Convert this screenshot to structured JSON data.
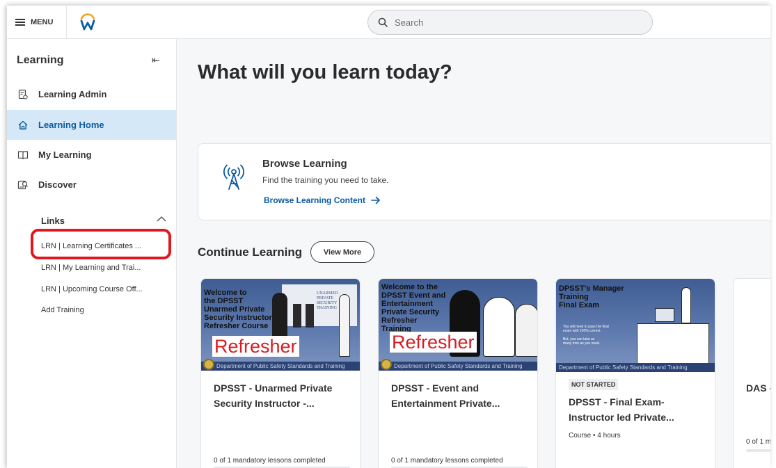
{
  "topbar": {
    "menu_label": "MENU",
    "search_placeholder": "Search"
  },
  "sidebar": {
    "title": "Learning",
    "items": [
      {
        "label": "Learning Admin",
        "icon": "admin-doc-icon"
      },
      {
        "label": "Learning Home",
        "icon": "home-icon",
        "active": true
      },
      {
        "label": "My Learning",
        "icon": "book-icon"
      },
      {
        "label": "Discover",
        "icon": "discover-icon"
      }
    ],
    "links_label": "Links",
    "links": [
      "LRN | Learning Certificates ...",
      "LRN | My Learning and Trai...",
      "LRN | Upcoming Course Off...",
      "Add Training"
    ]
  },
  "main": {
    "headline": "What will you learn today?",
    "browse": {
      "title": "Browse Learning",
      "description": "Find the training you need to take.",
      "link": "Browse Learning Content"
    },
    "continue_title": "Continue Learning",
    "view_more": "View More",
    "courses": [
      {
        "thumb_text": "Welcome to\nthe DPSST\nUnarmed Private\nSecurity Instructor\nRefresher Course",
        "thumb_banner": "Refresher",
        "thumb_sign": "UNARMED\nPRIVATE\nSECURITY\nTRAINING",
        "thumb_footer": "Department of Public Safety Standards and Training",
        "title": "DPSST - Unarmed Private Security Instructor -...",
        "status": "0 of 1 mandatory lessons completed"
      },
      {
        "thumb_text": "Welcome to the\nDPSST Event and\nEntertainment\nPrivate Security\nRefresher\nTraining",
        "thumb_banner": "Refresher",
        "thumb_footer": "Department of Public Safety Standards and Training",
        "title": "DPSST - Event and Entertainment Private...",
        "status": "0 of 1 mandatory lessons completed"
      },
      {
        "thumb_text": "DPSST's Manager\nTraining\nFinal Exam",
        "thumb_note": "You will need to pass the final\nexam with 100% correct.\n\nBut, you can take as\nmany tries as you need.",
        "thumb_footer": "Department of Public Safety Standards and Training",
        "badge": "NOT STARTED",
        "title": "DPSST - Final Exam-Instructor led Private...",
        "meta": "Course • 4 hours"
      },
      {
        "title": "DAS -",
        "status": "0 of 1 m"
      }
    ]
  },
  "colors": {
    "accent_blue": "#0b5ba3",
    "active_bg": "#d5e8f8",
    "highlight_red": "#e0181e",
    "banner_red": "#d71c23"
  }
}
